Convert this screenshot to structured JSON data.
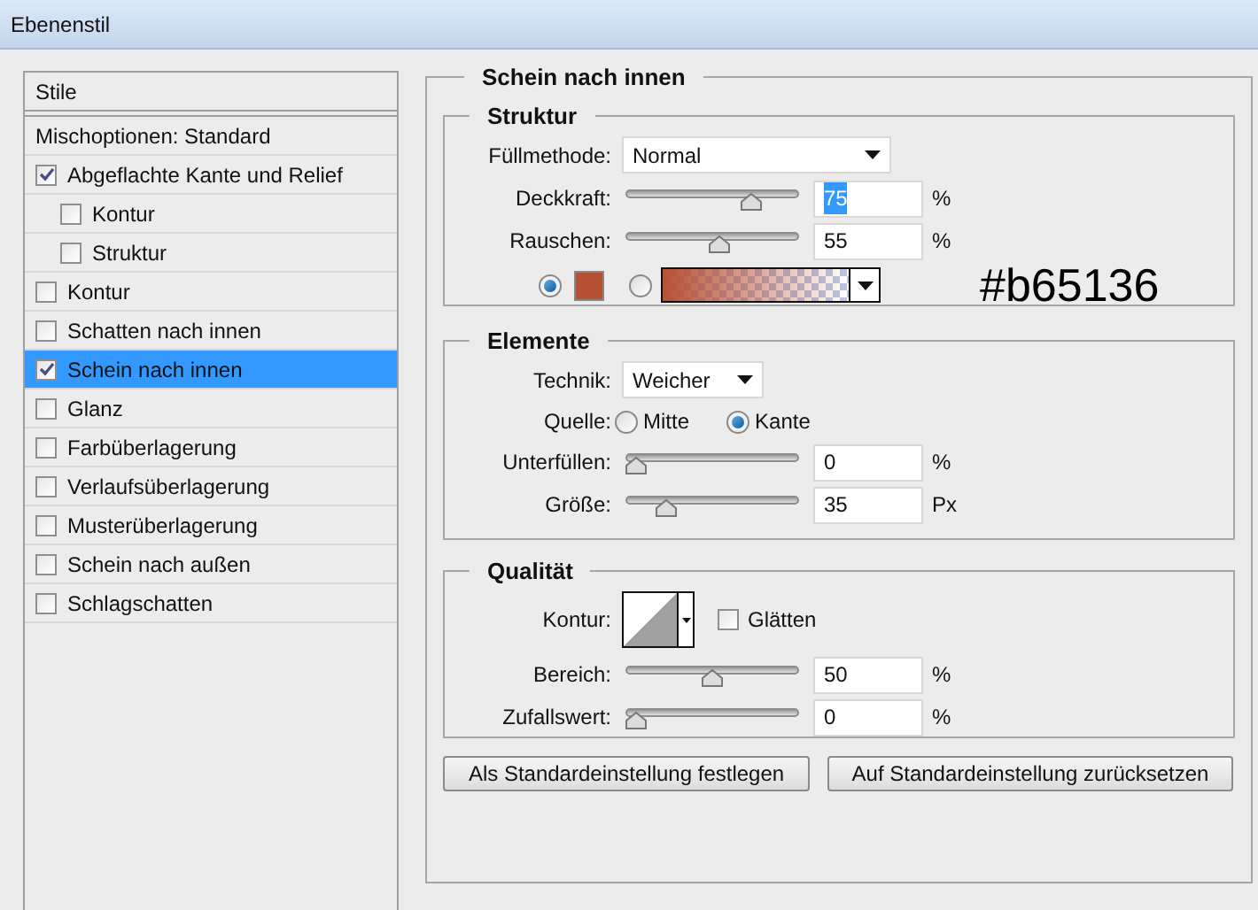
{
  "window": {
    "title": "Ebenenstil"
  },
  "styles": {
    "header": "Stile",
    "blending": "Mischoptionen: Standard",
    "items": [
      {
        "label": "Abgeflachte Kante und Relief",
        "checked": true,
        "selected": false,
        "children": [
          {
            "label": "Kontur",
            "checked": false,
            "selected": false
          },
          {
            "label": "Struktur",
            "checked": false,
            "selected": false
          }
        ]
      },
      {
        "label": "Kontur",
        "checked": false,
        "selected": false
      },
      {
        "label": "Schatten nach innen",
        "checked": false,
        "selected": false
      },
      {
        "label": "Schein nach innen",
        "checked": true,
        "selected": true
      },
      {
        "label": "Glanz",
        "checked": false,
        "selected": false
      },
      {
        "label": "Farbüberlagerung",
        "checked": false,
        "selected": false
      },
      {
        "label": "Verlaufsüberlagerung",
        "checked": false,
        "selected": false
      },
      {
        "label": "Musterüberlagerung",
        "checked": false,
        "selected": false
      },
      {
        "label": "Schein nach außen",
        "checked": false,
        "selected": false
      },
      {
        "label": "Schlagschatten",
        "checked": false,
        "selected": false
      }
    ]
  },
  "panel": {
    "title": "Schein nach innen",
    "structure": {
      "title": "Struktur",
      "fill_mode": {
        "label": "Füllmethode:",
        "value": "Normal"
      },
      "sliders": [
        {
          "label": "Deckkraft:",
          "value": "75",
          "unit": "%",
          "level": 0.75,
          "text_selected": true
        },
        {
          "label": "Rauschen:",
          "value": "55",
          "unit": "%",
          "level": 0.55,
          "text_selected": false
        }
      ],
      "color_source": [
        {
          "kind": "solid",
          "selected": true,
          "color": "#b65136"
        },
        {
          "kind": "gradient",
          "selected": false,
          "color": "#b65136"
        }
      ],
      "annotation": "#b65136"
    },
    "elements": {
      "title": "Elemente",
      "technique": {
        "label": "Technik:",
        "value": "Weicher"
      },
      "source": {
        "label": "Quelle:",
        "options": [
          {
            "label": "Mitte",
            "selected": false
          },
          {
            "label": "Kante",
            "selected": true
          }
        ]
      },
      "sliders": [
        {
          "label": "Unterfüllen:",
          "value": "0",
          "unit": "%",
          "level": 0,
          "text_selected": false
        },
        {
          "label": "Größe:",
          "value": "35",
          "unit": "Px",
          "level": 0.2,
          "text_selected": false
        }
      ]
    },
    "quality": {
      "title": "Qualität",
      "contour": {
        "label": "Kontur:"
      },
      "smooth": {
        "label": "Glätten",
        "checked": false
      },
      "sliders": [
        {
          "label": "Bereich:",
          "value": "50",
          "unit": "%",
          "level": 0.5,
          "text_selected": false
        },
        {
          "label": "Zufallswert:",
          "value": "0",
          "unit": "%",
          "level": 0,
          "text_selected": false
        }
      ]
    },
    "buttons": [
      "Als Standardeinstellung festlegen",
      "Auf Standardeinstellung zurücksetzen"
    ]
  }
}
